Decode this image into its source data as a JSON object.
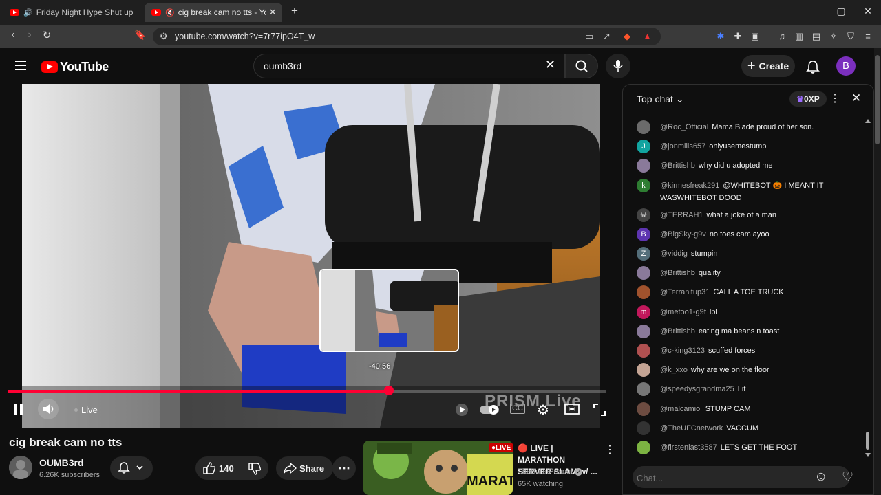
{
  "browser": {
    "tabs": [
      {
        "title": "Friday Night Hype Shut up about",
        "audio": true,
        "active": false
      },
      {
        "title": "cig break cam no tts - YouTube",
        "audio": true,
        "active": true
      }
    ],
    "new_tab": "+",
    "url": "youtube.com/watch?v=7r77ipO4T_w",
    "window_controls": {
      "minimize": "—",
      "maximize": "▢",
      "close": "✕"
    }
  },
  "header": {
    "logo": "YouTube",
    "search_value": "oumb3rd",
    "create_label": "Create",
    "avatar_letter": "B"
  },
  "player": {
    "preview_time": "-40:56",
    "live_label": "Live",
    "progress_fraction": 0.637,
    "watermark": "PRISM Live"
  },
  "video": {
    "title": "cig break cam no tts",
    "channel": "OUMB3rd",
    "subscribers": "6.26K subscribers",
    "likes": "140",
    "share_label": "Share"
  },
  "recommended": {
    "badge": "LIVE",
    "title": "🔴 LIVE | MARATHON SERVER SLAM w/ ...",
    "channel": "TheBurntPeanut",
    "watching": "65K watching",
    "thumb_text": "MARATHON"
  },
  "chat": {
    "mode": "Top chat",
    "xp": "0XP",
    "input_placeholder": "Chat...",
    "messages": [
      {
        "author": "@Roc_Official",
        "text": "Mama Blade proud of her son.",
        "avatar": "",
        "color": "#6b6b6b"
      },
      {
        "author": "@jonmills657",
        "text": "onlyusemestump",
        "avatar": "J",
        "color": "#12a4a0"
      },
      {
        "author": "@Brittishb",
        "text": "why did u adopted me",
        "avatar": "",
        "color": "#8a7a9a"
      },
      {
        "author": "@kirmesfreak291",
        "text": "@WHITEBOT 🎃 I MEANT IT WASWHITEBOT DOOD",
        "avatar": "k",
        "color": "#2e7d32"
      },
      {
        "author": "@TERRAH1",
        "text": "what a joke of a man",
        "avatar": "☠",
        "color": "#444"
      },
      {
        "author": "@BigSky-g9v",
        "text": "no toes cam ayoo",
        "avatar": "B",
        "color": "#5e35b1"
      },
      {
        "author": "@viddig",
        "text": "stumpin",
        "avatar": "Z",
        "color": "#546e7a"
      },
      {
        "author": "@Brittishb",
        "text": "quality",
        "avatar": "",
        "color": "#8a7a9a"
      },
      {
        "author": "@Terranitup31",
        "text": "CALL A TOE TRUCK",
        "avatar": "",
        "color": "#a0522d"
      },
      {
        "author": "@metoo1-g9f",
        "text": "lpl",
        "avatar": "m",
        "color": "#c2185b"
      },
      {
        "author": "@Brittishb",
        "text": "eating ma beans n toast",
        "avatar": "",
        "color": "#8a7a9a"
      },
      {
        "author": "@c-king3123",
        "text": "scuffed forces",
        "avatar": "",
        "color": "#b05050"
      },
      {
        "author": "@k_xxo",
        "text": "why are we on the floor",
        "avatar": "",
        "color": "#c4a494"
      },
      {
        "author": "@speedysgrandma25",
        "text": "Lit",
        "avatar": "",
        "color": "#777"
      },
      {
        "author": "@malcamiol",
        "text": "STUMP CAM",
        "avatar": "",
        "color": "#6d4c41"
      },
      {
        "author": "@TheUFCnetwork",
        "text": "VACCUM",
        "avatar": "",
        "color": "#333"
      },
      {
        "author": "@firstenlast3587",
        "text": "LETS GET THE FOOT",
        "avatar": "",
        "color": "#7cb342"
      }
    ]
  }
}
